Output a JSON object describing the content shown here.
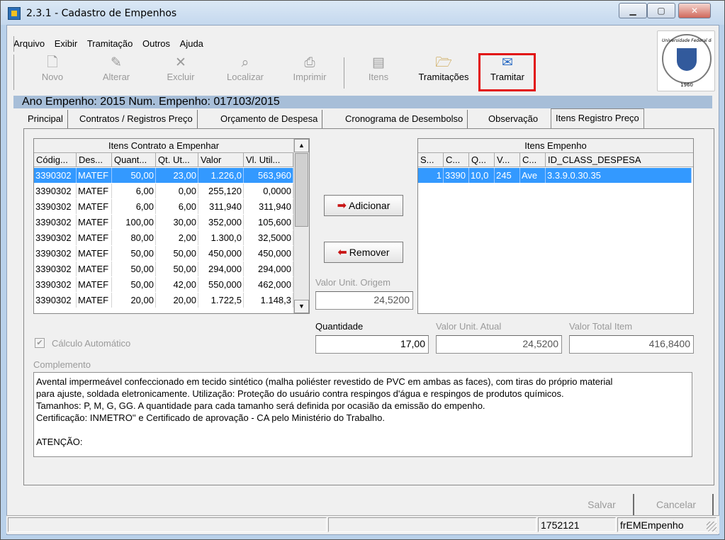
{
  "window": {
    "title": "2.3.1 - Cadastro de Empenhos"
  },
  "menu": [
    {
      "label": "Arquivo"
    },
    {
      "label": "Exibir"
    },
    {
      "label": "Tramitação"
    },
    {
      "label": "Outros"
    },
    {
      "label": "Ajuda"
    }
  ],
  "toolbar": {
    "novo": "Novo",
    "alterar": "Alterar",
    "excluir": "Excluir",
    "localizar": "Localizar",
    "imprimir": "Imprimir",
    "itens": "Itens",
    "tramitacoes": "Tramitações",
    "tramitar": "Tramitar"
  },
  "logo": {
    "arc_text": "Universidade Federal de Santa Maria",
    "year": "1960"
  },
  "header": {
    "text": "Ano Empenho:  2015   Num. Empenho:  017103/2015"
  },
  "tabs": [
    {
      "label": "Principal"
    },
    {
      "label": "Contratos / Registros Preço"
    },
    {
      "label": "Orçamento de Despesa"
    },
    {
      "label": "Cronograma de Desembolso"
    },
    {
      "label": "Observação"
    },
    {
      "label": "Itens Registro Preço"
    }
  ],
  "left_grid": {
    "title": "Itens Contrato a Empenhar",
    "columns": [
      "Códig...",
      "Des...",
      "Quant...",
      "Qt. Ut...",
      "Valor",
      "Vl. Util..."
    ],
    "rows": [
      [
        "3390302",
        "MATEF",
        "50,00",
        "23,00",
        "1.226,0",
        "563,960"
      ],
      [
        "3390302",
        "MATEF",
        "6,00",
        "0,00",
        "255,120",
        "0,0000"
      ],
      [
        "3390302",
        "MATEF",
        "6,00",
        "6,00",
        "311,940",
        "311,940"
      ],
      [
        "3390302",
        "MATEF",
        "100,00",
        "30,00",
        "352,000",
        "105,600"
      ],
      [
        "3390302",
        "MATEF",
        "80,00",
        "2,00",
        "1.300,0",
        "32,5000"
      ],
      [
        "3390302",
        "MATEF",
        "50,00",
        "50,00",
        "450,000",
        "450,000"
      ],
      [
        "3390302",
        "MATEF",
        "50,00",
        "50,00",
        "294,000",
        "294,000"
      ],
      [
        "3390302",
        "MATEF",
        "50,00",
        "42,00",
        "550,000",
        "462,000"
      ],
      [
        "3390302",
        "MATEF",
        "20,00",
        "20,00",
        "1.722,5",
        "1.148,3"
      ]
    ]
  },
  "right_grid": {
    "title": "Itens Empenho",
    "columns": [
      "S...",
      "C...",
      "Q...",
      "V...",
      "C...",
      "ID_CLASS_DESPESA"
    ],
    "rows": [
      [
        "1",
        "3390",
        "10,0",
        "245",
        "Ave",
        "3.3.9.0.30.35"
      ]
    ]
  },
  "buttons": {
    "adicionar": "Adicionar",
    "remover": "Remover",
    "salvar": "Salvar",
    "cancelar": "Cancelar"
  },
  "fields": {
    "valor_unit_origem_label": "Valor Unit. Origem",
    "valor_unit_origem": "24,5200",
    "quantidade_label": "Quantidade",
    "quantidade": "17,00",
    "valor_unit_atual_label": "Valor Unit. Atual",
    "valor_unit_atual": "24,5200",
    "valor_total_item_label": "Valor Total Item",
    "valor_total_item": "416,8400"
  },
  "calculo_automatico": {
    "label": "Cálculo Automático",
    "checked": true
  },
  "complemento": {
    "label": "Complemento",
    "text": "Avental impermeável confeccionado em tecido sintético (malha poliéster revestido de PVC em ambas as faces), com tiras do próprio material\npara ajuste, soldada eletronicamente. Utilização:  Proteção do usuário contra respingos d'água e respingos de produtos químicos.\nTamanhos: P, M, G, GG. A quantidade para cada tamanho será definida por ocasião da emissão do empenho.\nCertificação: INMETRO'' e Certificado de aprovação - CA pelo Ministério do Trabalho.\n\nATENÇÃO:"
  },
  "status": {
    "user_id": "1752121",
    "form": "frEMEmpenho"
  }
}
